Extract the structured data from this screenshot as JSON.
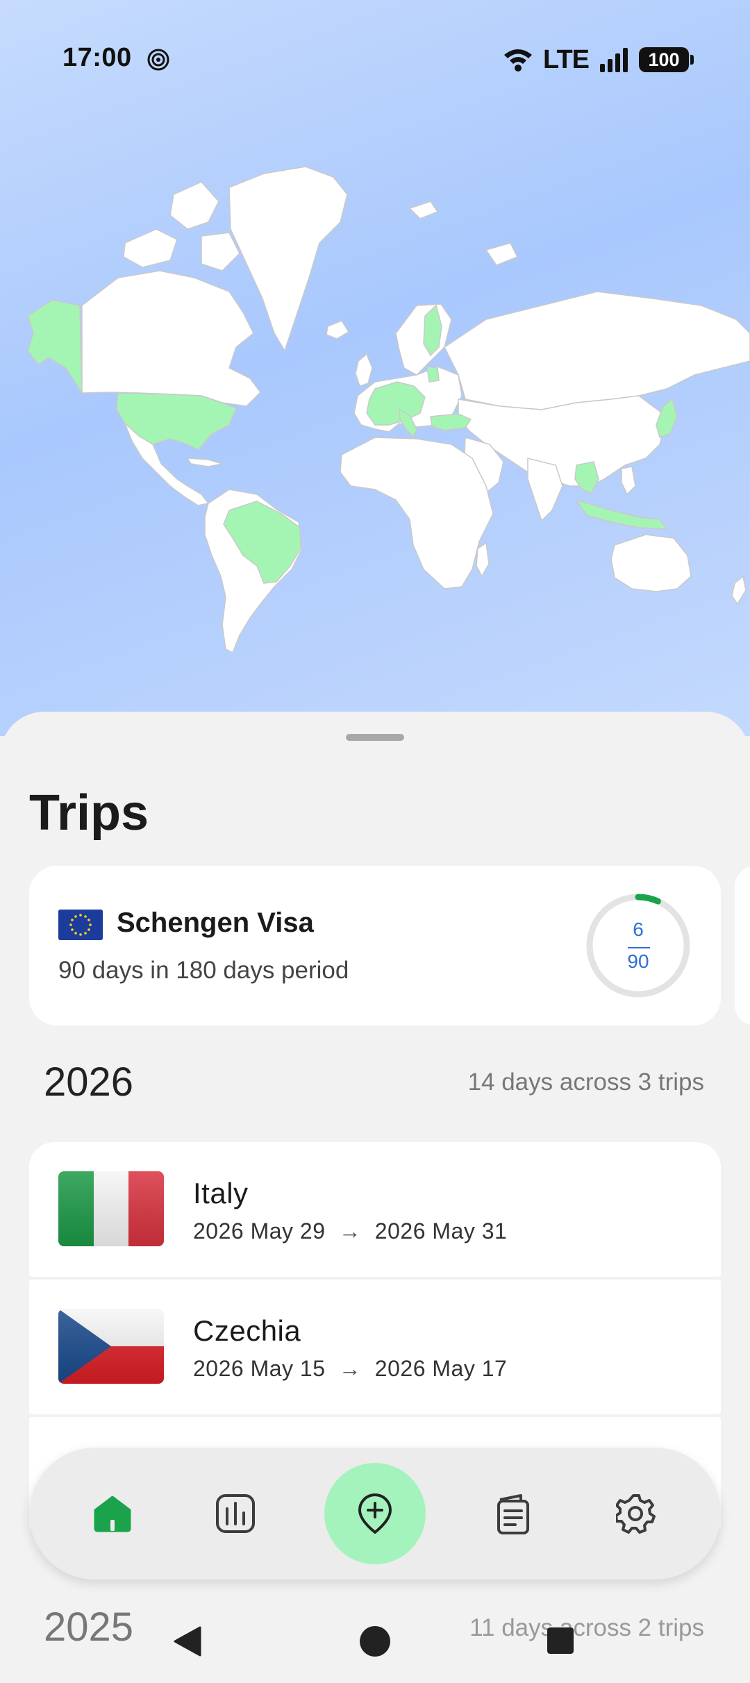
{
  "status_bar": {
    "time": "17:00",
    "network": "LTE",
    "battery": "100",
    "icons": [
      "hotspot-icon",
      "wifi-icon",
      "signal-icon",
      "battery-icon"
    ]
  },
  "map": {
    "visited_color": "#a4f5b3",
    "land_color": "#ffffff",
    "water_color": "#a9c8fd"
  },
  "sheet": {
    "title": "Trips",
    "visa": {
      "name": "Schengen Visa",
      "rule": "90 days in 180 days period",
      "used": "6",
      "limit": "90",
      "used_fraction": 0.0667,
      "ring_color": "#1aa34a"
    },
    "years": [
      {
        "year": "2026",
        "summary": "14 days across 3 trips",
        "trips": [
          {
            "country": "Italy",
            "start": "2026 May 29",
            "arrow": "→",
            "end": "2026 May 31"
          },
          {
            "country": "Czechia",
            "start": "2026 May 15",
            "arrow": "→",
            "end": "2026 May 17"
          }
        ]
      },
      {
        "year": "2025",
        "summary": "11 days across 2 trips"
      }
    ]
  },
  "bottom_nav": {
    "items": [
      "home-icon",
      "stats-icon",
      "add-trip-icon",
      "passport-icon",
      "settings-icon"
    ],
    "active": "home-icon",
    "accent": "#1aa34a",
    "fab_color": "#a4f3bd"
  },
  "system_nav": [
    "back-icon",
    "home-circle-icon",
    "recents-icon"
  ]
}
